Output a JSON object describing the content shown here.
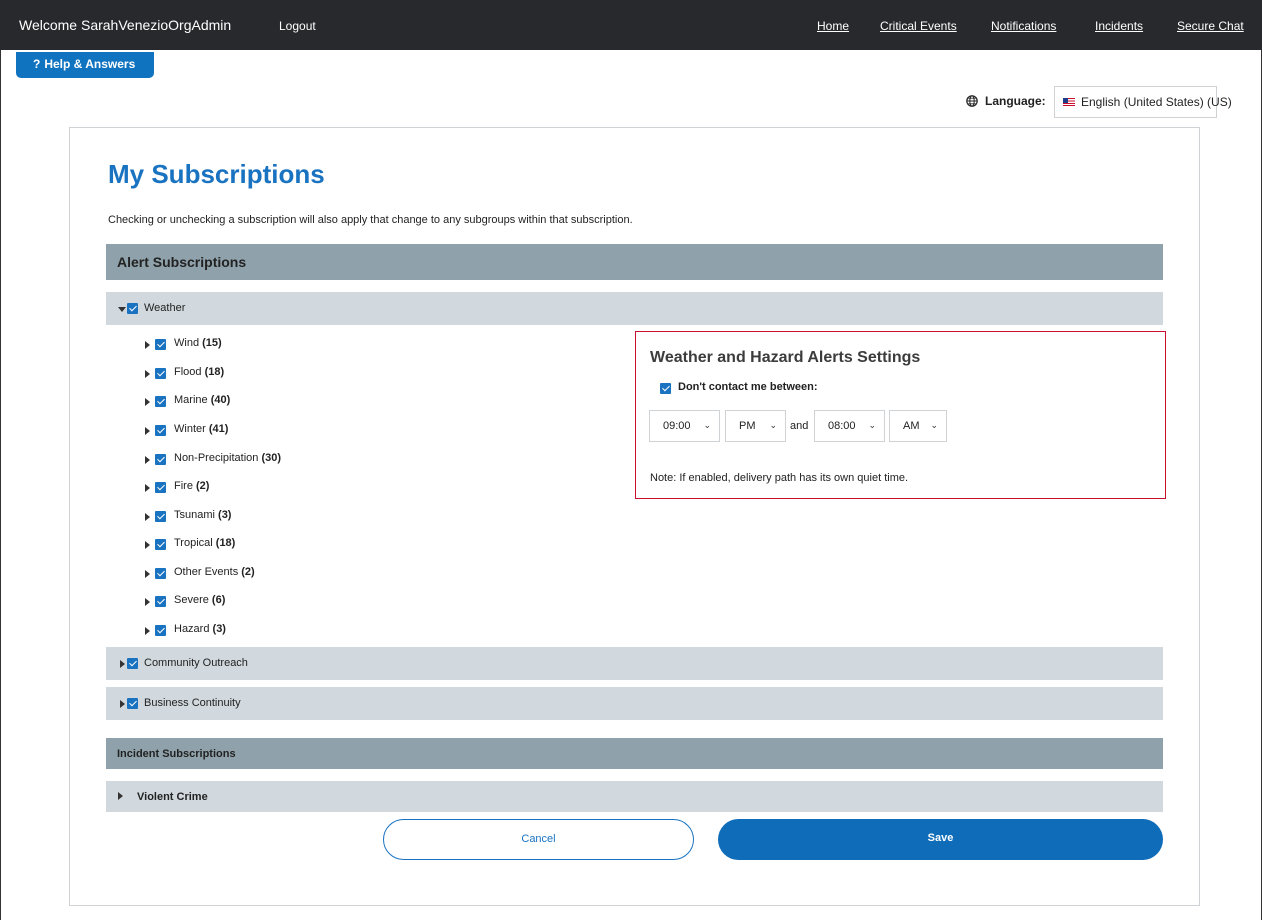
{
  "header": {
    "welcome_text": "Welcome SarahVenezioOrgAdmin",
    "logout_label": "Logout",
    "nav": [
      "Home",
      "Critical Events",
      "Notifications",
      "Incidents",
      "Secure Chat"
    ]
  },
  "help_button": {
    "label": "Help & Answers"
  },
  "language": {
    "label": "Language:",
    "value": "English (United States) (US)"
  },
  "page": {
    "title": "My Subscriptions",
    "intro": "Checking or unchecking a subscription will also apply that change to any subgroups within that subscription."
  },
  "alert_subscriptions": {
    "heading": "Alert Subscriptions",
    "weather": {
      "label": "Weather",
      "checked": true,
      "expanded": true,
      "subgroups": [
        {
          "name": "Wind",
          "count": "(15)",
          "checked": true
        },
        {
          "name": "Flood",
          "count": "(18)",
          "checked": true
        },
        {
          "name": "Marine",
          "count": "(40)",
          "checked": true
        },
        {
          "name": "Winter",
          "count": "(41)",
          "checked": true
        },
        {
          "name": "Non-Precipitation",
          "count": "(30)",
          "checked": true
        },
        {
          "name": "Fire",
          "count": "(2)",
          "checked": true
        },
        {
          "name": "Tsunami",
          "count": "(3)",
          "checked": true
        },
        {
          "name": "Tropical",
          "count": "(18)",
          "checked": true
        },
        {
          "name": "Other Events",
          "count": "(2)",
          "checked": true
        },
        {
          "name": "Severe",
          "count": "(6)",
          "checked": true
        },
        {
          "name": "Hazard",
          "count": "(3)",
          "checked": true
        }
      ]
    },
    "community_outreach": {
      "label": "Community Outreach",
      "checked": true
    },
    "business_continuity": {
      "label": "Business Continuity",
      "checked": true
    }
  },
  "settings_panel": {
    "title": "Weather and Hazard Alerts Settings",
    "dont_contact_label": "Don't contact me between:",
    "dont_contact_checked": true,
    "start_time": "09:00",
    "start_period": "PM",
    "and_text": "and",
    "end_time": "08:00",
    "end_period": "AM",
    "note": "Note: If enabled, delivery path has its own quiet time."
  },
  "incident_subscriptions": {
    "heading": "Incident Subscriptions",
    "violent_crime": {
      "label": "Violent Crime"
    }
  },
  "buttons": {
    "cancel": "Cancel",
    "save": "Save"
  },
  "colors": {
    "accent": "#1a73c1",
    "topbar": "#27292d",
    "section_bar": "#8fa2ab",
    "group_bar": "#d1d9de",
    "panel_border": "#c8102e"
  },
  "icons": {
    "help": "question-mark",
    "language": "globe",
    "flag": "us-flag",
    "expand": "caret-right",
    "collapse": "caret-down",
    "checkbox": "checkmark",
    "select": "chevron-down"
  }
}
